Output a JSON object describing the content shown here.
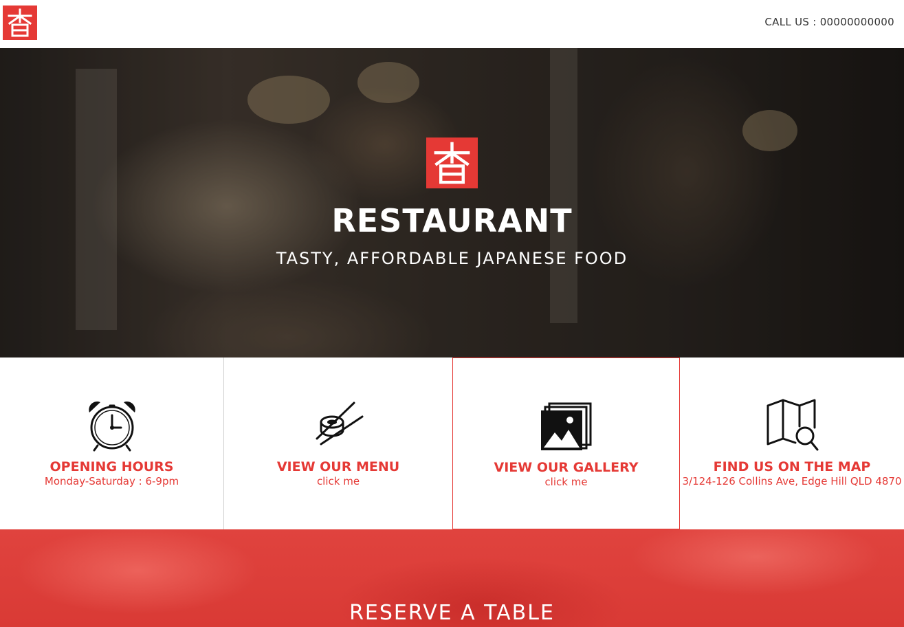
{
  "header": {
    "logo_icon": "restaurant-kanji-logo-icon",
    "call_us": "CALL US : 00000000000"
  },
  "hero": {
    "title": "RESTAURANT",
    "subtitle": "TASTY, AFFORDABLE JAPANESE FOOD",
    "logo_icon": "restaurant-kanji-logo-icon"
  },
  "features": [
    {
      "icon": "alarm-clock-icon",
      "title": "OPENING HOURS",
      "subtitle": "Monday-Saturday : 6-9pm"
    },
    {
      "icon": "sushi-chopsticks-icon",
      "title": "VIEW OUR MENU",
      "subtitle": "click me"
    },
    {
      "icon": "photo-gallery-icon",
      "title": "VIEW OUR GALLERY",
      "subtitle": "click me"
    },
    {
      "icon": "map-search-icon",
      "title": "FIND US ON THE MAP",
      "subtitle": "3/124-126 Collins Ave, Edge Hill QLD 4870"
    }
  ],
  "reserve": {
    "title": "RESERVE A TABLE"
  },
  "colors": {
    "accent": "#e53935",
    "text": "#333333",
    "white": "#ffffff"
  }
}
